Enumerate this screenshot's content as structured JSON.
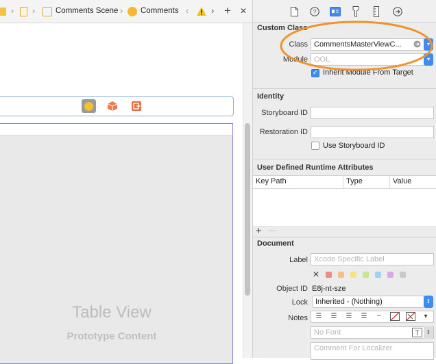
{
  "jumpbar": {
    "crumbs": [
      "Comments Scene",
      "Comments"
    ],
    "add_symbol": "+",
    "close_symbol": "✕"
  },
  "canvas": {
    "table_title": "Table View",
    "table_subtitle": "Prototype Content"
  },
  "inspector": {
    "custom_class": {
      "heading": "Custom Class",
      "class_label": "Class",
      "class_value": "CommentsMasterViewC...",
      "module_label": "Module",
      "module_placeholder": "OOL",
      "inherit_label": "Inherit Module From Target",
      "inherit_checked": true
    },
    "identity": {
      "heading": "Identity",
      "storyboard_id_label": "Storyboard ID",
      "restoration_id_label": "Restoration ID",
      "use_storyboard_id_label": "Use Storyboard ID"
    },
    "runtime_attributes": {
      "heading": "User Defined Runtime Attributes",
      "columns": [
        "Key Path",
        "Type",
        "Value"
      ],
      "add_symbol": "+",
      "remove_symbol": "—"
    },
    "document": {
      "heading": "Document",
      "label_label": "Label",
      "label_placeholder": "Xcode Specific Label",
      "object_id_label": "Object ID",
      "object_id_value": "E8j-nt-sze",
      "lock_label": "Lock",
      "lock_value": "Inherited - (Nothing)",
      "notes_label": "Notes",
      "font_placeholder": "No Font",
      "comment_placeholder": "Comment For Localizer",
      "color_swatches": [
        "#f28b82",
        "#fbbc80",
        "#f7e27f",
        "#c8e68a",
        "#9fd0f5",
        "#d8a8ec",
        "#c9c9c9"
      ]
    }
  },
  "colors": {
    "accent": "#3f8cf0",
    "highlight_ring": "#f0922b"
  }
}
